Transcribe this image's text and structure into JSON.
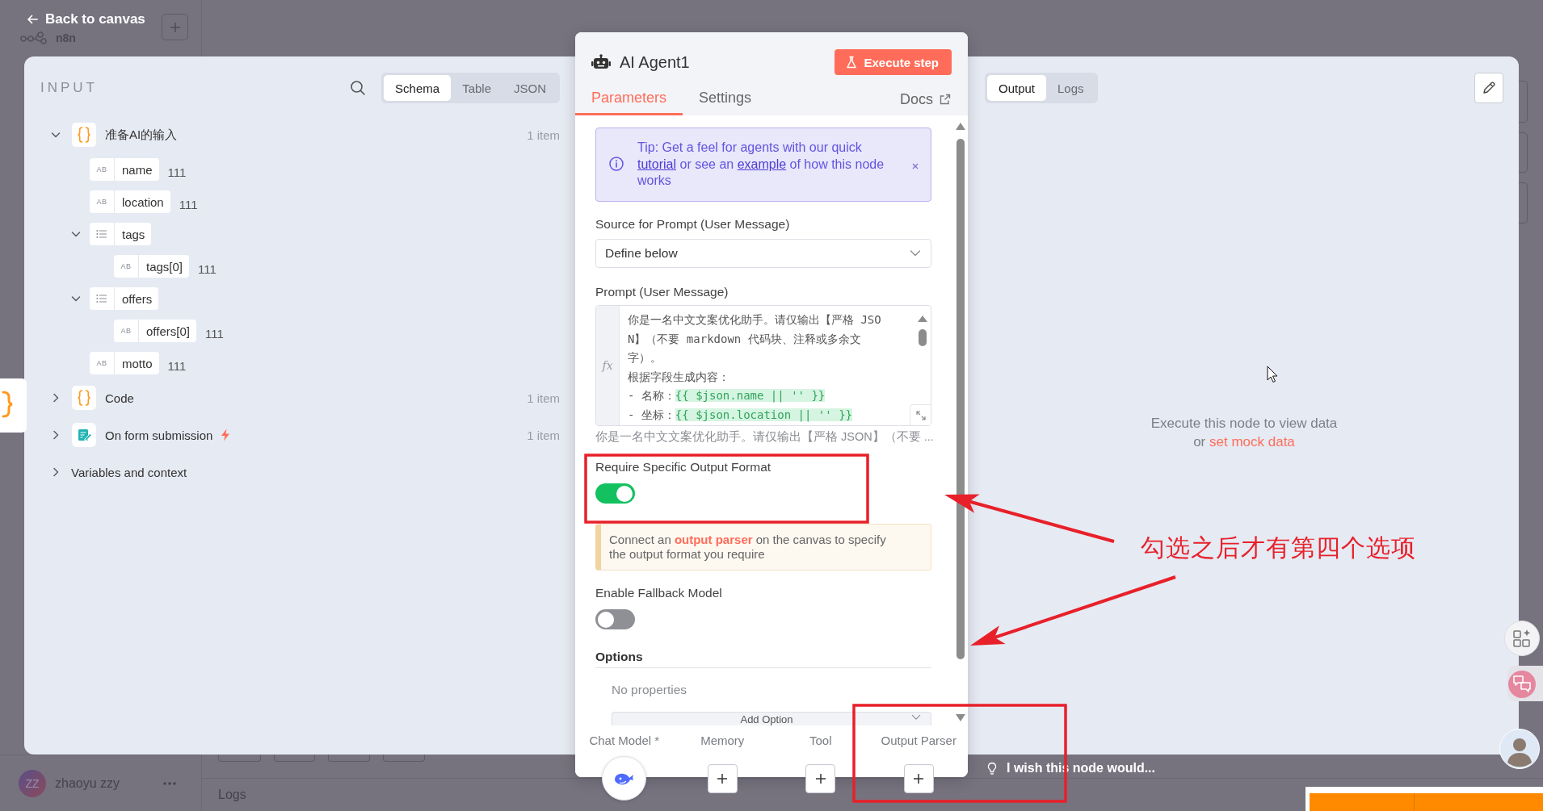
{
  "top_bar": {
    "back_link": "Back to canvas",
    "app_name": "n8n"
  },
  "input_panel": {
    "title": "INPUT",
    "view_tabs": [
      {
        "label": "Schema",
        "selected": true
      },
      {
        "label": "Table",
        "selected": false
      },
      {
        "label": "JSON",
        "selected": false
      }
    ],
    "tree": [
      {
        "kind": "code",
        "label": "准备AI的输入",
        "count": "1 item",
        "expanded": true,
        "children": [
          {
            "kind": "string",
            "type_label": "AB",
            "label": "name",
            "value": "111"
          },
          {
            "kind": "string",
            "type_label": "AB",
            "label": "location",
            "value": "111"
          },
          {
            "kind": "array",
            "label": "tags",
            "expanded": true,
            "children": [
              {
                "kind": "string",
                "type_label": "AB",
                "label": "tags[0]",
                "value": "111"
              }
            ]
          },
          {
            "kind": "array",
            "label": "offers",
            "expanded": true,
            "children": [
              {
                "kind": "string",
                "type_label": "AB",
                "label": "offers[0]",
                "value": "111"
              }
            ]
          },
          {
            "kind": "string",
            "type_label": "AB",
            "label": "motto",
            "value": "111"
          }
        ]
      },
      {
        "kind": "code",
        "label": "Code",
        "count": "1 item",
        "expanded": false
      },
      {
        "kind": "trigger",
        "label": "On form submission",
        "count": "1 item",
        "expanded": false
      },
      {
        "kind": "group",
        "label": "Variables and context",
        "expanded": false
      }
    ]
  },
  "node_panel": {
    "title": "AI Agent1",
    "execute_button": "Execute step",
    "tabs": [
      {
        "label": "Parameters",
        "selected": true
      },
      {
        "label": "Settings",
        "selected": false
      }
    ],
    "docs_link": "Docs",
    "parameters": [
      {
        "kind": "tip",
        "parts": [
          {
            "kind": "text",
            "text": "Tip: Get a feel for agents with our quick "
          },
          {
            "kind": "link",
            "text": "tutorial"
          },
          {
            "kind": "text",
            "text": " or see an "
          },
          {
            "kind": "link",
            "text": "example"
          },
          {
            "kind": "text",
            "text": " of how this node works"
          }
        ]
      },
      {
        "kind": "select",
        "label": "Source for Prompt (User Message)",
        "value": "Define below"
      },
      {
        "kind": "editor",
        "label": "Prompt (User Message)",
        "gutter": "fx",
        "lines": [
          {
            "text": "你是一名中文文案优化助手。请仅输出【严格 JSO"
          },
          {
            "text": "N】（不要 markdown 代码块、注释或多余文"
          },
          {
            "text": "字）。"
          },
          {
            "text": "根据字段生成内容："
          },
          {
            "text": "- 名称：",
            "expression": "{{ $json.name || '' }}"
          },
          {
            "text": "- 坐标：",
            "expression": "{{ $json.location || '' }}"
          }
        ],
        "preview": "你是一名中文文案优化助手。请仅输出【严格 JSON】（不要 ..."
      },
      {
        "kind": "toggle",
        "label": "Require Specific Output Format",
        "on": true
      },
      {
        "kind": "notice",
        "parts": [
          {
            "kind": "text",
            "text": "Connect an "
          },
          {
            "kind": "link",
            "text": "output parser"
          },
          {
            "kind": "text",
            "text": " on the canvas to specify the output format you require"
          }
        ]
      },
      {
        "kind": "toggle",
        "label": "Enable Fallback Model",
        "on": false
      },
      {
        "kind": "collection",
        "label": "Options",
        "empty_text": "No properties",
        "button": "Add Option"
      }
    ],
    "connectors": [
      {
        "label": "Chat Model *",
        "connected": true
      },
      {
        "label": "Memory",
        "connected": false
      },
      {
        "label": "Tool",
        "connected": false
      },
      {
        "label": "Output Parser",
        "connected": false
      }
    ]
  },
  "output_panel": {
    "view_tabs": [
      {
        "label": "Output",
        "selected": true
      },
      {
        "label": "Logs",
        "selected": false
      }
    ],
    "message": "Execute this node to view data",
    "hint_parts": [
      {
        "kind": "text",
        "text": "or "
      },
      {
        "kind": "link",
        "text": "set mock data"
      }
    ]
  },
  "feedback_prompt": "I wish this node would...",
  "user": {
    "initials": "ZZ",
    "name": "zhaoyu zzy"
  },
  "canvas": {
    "logs_label": "Logs"
  },
  "annotation": {
    "text": "勾选之后才有第四个选项"
  }
}
